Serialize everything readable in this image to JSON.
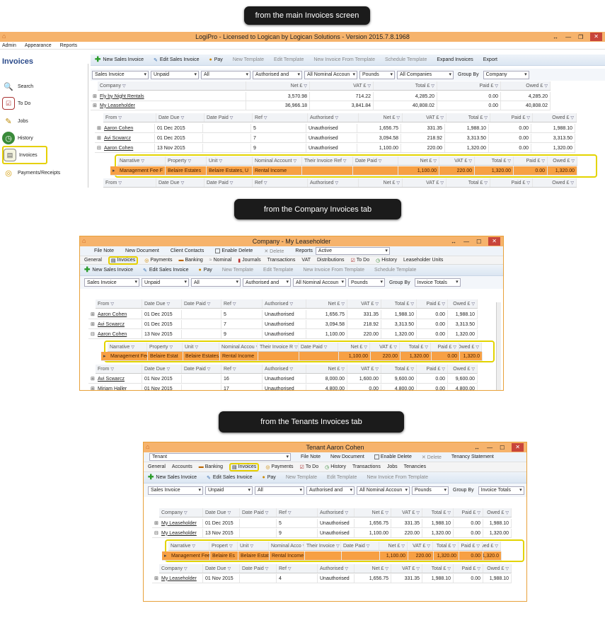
{
  "captions": [
    "from the main Invoices screen",
    "from the Company Invoices tab",
    "from the Tenants Invoices tab"
  ],
  "main": {
    "title": "LogiPro - Licensed to Logican by Logican Solutions - Version 2015.7.8.1968",
    "menu": [
      "Admin",
      "Appearance",
      "Reports"
    ],
    "panel_title": "Invoices",
    "sidebar": [
      "Search",
      "To Do",
      "Jobs",
      "History",
      "Invoices",
      "Payments/Receipts"
    ],
    "toolbar": [
      "New Sales Invoice",
      "Edit Sales Invoice",
      "Pay",
      "New Template",
      "Edit Template",
      "New Invoice From Template",
      "Schedule Template",
      "Expand Invoices",
      "Export"
    ],
    "filters": [
      "Sales Invoice",
      "Unpaid",
      "All",
      "Authorised and",
      "All Nominal Accoun",
      "Pounds",
      "All Companies"
    ],
    "group_by_label": "Group By",
    "group_by": "Company",
    "top_headers": [
      "Company",
      "Net £",
      "VAT £",
      "Total £",
      "Paid £",
      "Owed £"
    ],
    "top_rows": [
      [
        "Fly by Night Rentals",
        "3,570.98",
        "714.22",
        "4,285.20",
        "0.00",
        "4,285.20"
      ],
      [
        "My Leaseholder",
        "36,966.18",
        "3,841.84",
        "40,808.02",
        "0.00",
        "40,808.02"
      ]
    ],
    "headers": [
      "From",
      "Date Due",
      "Date Paid",
      "Ref",
      "Authorised",
      "Net £",
      "VAT £",
      "Total £",
      "Paid £",
      "Owed £"
    ],
    "rows": [
      [
        "Aaron Cohen",
        "01 Dec 2015",
        "",
        "5",
        "Unauthorised",
        "1,656.75",
        "331.35",
        "1,988.10",
        "0.00",
        "1,988.10"
      ],
      [
        "Avi Scwarcz",
        "01 Dec 2015",
        "",
        "7",
        "Unauthorised",
        "3,094.58",
        "218.92",
        "3,313.50",
        "0.00",
        "3,313.50"
      ],
      [
        "Aaron Cohen",
        "13 Nov 2015",
        "",
        "9",
        "Unauthorised",
        "1,100.00",
        "220.00",
        "1,320.00",
        "0.00",
        "1,320.00"
      ]
    ],
    "nested_headers": [
      "Narrative",
      "Property",
      "Unit",
      "Nominal Account",
      "Their Invoice Ref",
      "Date Paid",
      "Net £",
      "VAT £",
      "Total £",
      "Paid £",
      "Owed £"
    ],
    "nested_row": [
      "Management Fee F",
      "Belaire Estates",
      "Belaire Estates, U",
      "Rental Income",
      "",
      "",
      "1,100.00",
      "220.00",
      "1,320.00",
      "0.00",
      "1,320.00"
    ]
  },
  "company": {
    "title": "Company - My Leaseholder",
    "actions": [
      "File Note",
      "New Document",
      "Client Contacts",
      "Enable Delete",
      "Delete",
      "Reports"
    ],
    "reports_value": "Active",
    "tabs": [
      "General",
      "Invoices",
      "Payments",
      "Banking",
      "Nominal",
      "Journals",
      "Transactions",
      "VAT",
      "Distributions",
      "To Do",
      "History",
      "Leaseholder Units"
    ],
    "toolbar": [
      "New Sales Invoice",
      "Edit Sales Invoice",
      "Pay",
      "New Template",
      "Edit Template",
      "New Invoice From Template",
      "Schedule Template"
    ],
    "filters": [
      "Sales Invoice",
      "Unpaid",
      "All",
      "Authorised and",
      "All Nominal Accoun",
      "Pounds"
    ],
    "group_by_label": "Group By",
    "group_by": "Invoice Totals",
    "headers": [
      "From",
      "Date Due",
      "Date Paid",
      "Ref",
      "Authorised",
      "Net £",
      "VAT £",
      "Total £",
      "Paid £",
      "Owed £"
    ],
    "rows": [
      [
        "Aaron Cohen",
        "01 Dec 2015",
        "",
        "5",
        "Unauthorised",
        "1,656.75",
        "331.35",
        "1,988.10",
        "0.00",
        "1,988.10"
      ],
      [
        "Avi Scwarcz",
        "01 Dec 2015",
        "",
        "7",
        "Unauthorised",
        "3,094.58",
        "218.92",
        "3,313.50",
        "0.00",
        "3,313.50"
      ],
      [
        "Aaron Cohen",
        "13 Nov 2015",
        "",
        "9",
        "Unauthorised",
        "1,100.00",
        "220.00",
        "1,320.00",
        "0.00",
        "1,320.00"
      ]
    ],
    "nested_headers": [
      "Narrative",
      "Property",
      "Unit",
      "Nominal Accou",
      "Their Invoice R",
      "Date Paid",
      "Net £",
      "VAT £",
      "Total £",
      "Paid £",
      "Owed £"
    ],
    "nested_row": [
      "Management Fee",
      "Belaire Estat",
      "Belaire Estates,",
      "Rental Income",
      "",
      "",
      "1,100.00",
      "220.00",
      "1,320.00",
      "0.00",
      "1,320.0"
    ],
    "rows2": [
      [
        "Avi Scwarcz",
        "01 Nov 2015",
        "",
        "16",
        "Unauthorised",
        "8,000.00",
        "1,600.00",
        "9,600.00",
        "0.00",
        "9,600.00"
      ],
      [
        "Miriam Haller",
        "01 Nov 2015",
        "",
        "17",
        "Unauthorised",
        "4,800.00",
        "0.00",
        "4,800.00",
        "0.00",
        "4,800.00"
      ]
    ]
  },
  "tenant": {
    "title": "Tenant Aaron Cohen",
    "tenant_select": "Tenant",
    "actions": [
      "File Note",
      "New Document",
      "Enable Delete",
      "Delete",
      "Tenancy Statement"
    ],
    "tabs": [
      "General",
      "Accounts",
      "Banking",
      "Invoices",
      "Payments",
      "To Do",
      "History",
      "Transactions",
      "Jobs",
      "Tenancies"
    ],
    "toolbar": [
      "New Sales Invoice",
      "Edit Sales Invoice",
      "Pay",
      "New Template",
      "Edit Template",
      "New Invoice From Template"
    ],
    "filters": [
      "Sales Invoice",
      "Unpaid",
      "All",
      "Authorised and",
      "All Nominal Accoun",
      "Pounds"
    ],
    "group_by_label": "Group By",
    "group_by": "Invoice Totals",
    "headers": [
      "Company",
      "Date Due",
      "Date Paid",
      "Ref",
      "Authorised",
      "Net £",
      "VAT £",
      "Total £",
      "Paid £",
      "Owed £"
    ],
    "rows": [
      [
        "My Leaseholder",
        "01 Dec 2015",
        "",
        "5",
        "Unauthorised",
        "1,656.75",
        "331.35",
        "1,988.10",
        "0.00",
        "1,988.10"
      ],
      [
        "My Leaseholder",
        "13 Nov 2015",
        "",
        "9",
        "Unauthorised",
        "1,100.00",
        "220.00",
        "1,320.00",
        "0.00",
        "1,320.00"
      ]
    ],
    "nested_headers": [
      "Narrative",
      "Propert",
      "Unit",
      "Nominal Acco",
      "Their Invoice",
      "Date Paid",
      "Net £",
      "VAT £",
      "Total £",
      "Paid £",
      "Owed £"
    ],
    "nested_row": [
      "Management Fee",
      "Belaire Es",
      "Belaire Estate",
      "Rental Income",
      "",
      "",
      "1,100.00",
      "220.00",
      "1,320.00",
      "0.00",
      "1,320.0"
    ],
    "rows2": [
      [
        "My Leaseholder",
        "01 Nov 2015",
        "",
        "4",
        "Unauthorised",
        "1,656.75",
        "331.35",
        "1,988.10",
        "0.00",
        "1,988.10"
      ]
    ]
  }
}
